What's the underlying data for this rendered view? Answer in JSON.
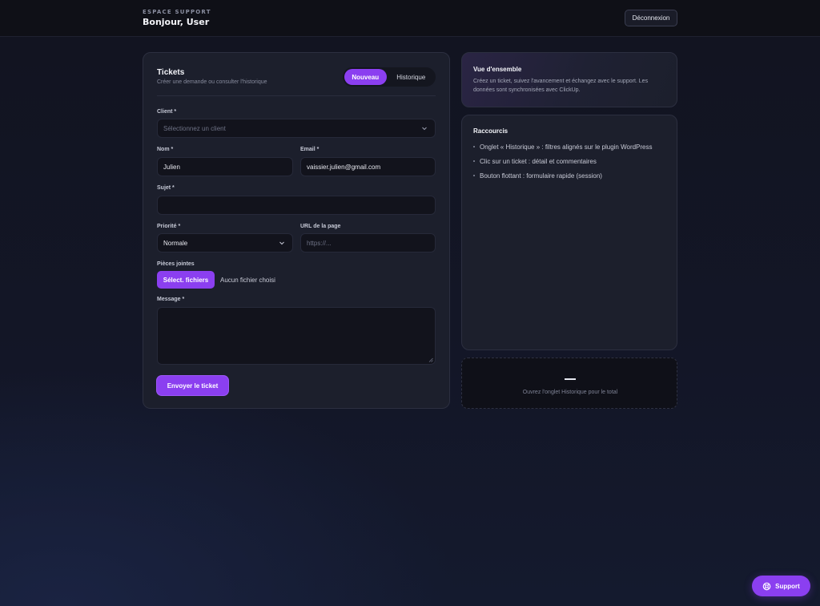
{
  "header": {
    "eyebrow": "ESPACE SUPPORT",
    "greeting": "Bonjour, User",
    "logout_label": "Déconnexion"
  },
  "tickets": {
    "title": "Tickets",
    "subtitle": "Créer une demande ou consulter l'historique",
    "tabs": [
      {
        "label": "Nouveau",
        "active": true
      },
      {
        "label": "Historique",
        "active": false
      }
    ],
    "form": {
      "client": {
        "label": "Client *",
        "placeholder": "Sélectionnez un client"
      },
      "nom": {
        "label": "Nom *",
        "value": "Julien"
      },
      "email": {
        "label": "Email *",
        "value": "vaissier.julien@gmail.com"
      },
      "sujet": {
        "label": "Sujet *",
        "value": ""
      },
      "priorite": {
        "label": "Priorité *",
        "value": "Normale"
      },
      "url": {
        "label": "URL de la page",
        "placeholder": "https://..."
      },
      "attachments": {
        "label": "Pièces jointes",
        "button_label": "Sélect. fichiers",
        "status": "Aucun fichier choisi"
      },
      "message": {
        "label": "Message *",
        "value": ""
      },
      "submit_label": "Envoyer le ticket"
    }
  },
  "overview": {
    "title": "Vue d'ensemble",
    "text": "Créez un ticket, suivez l'avancement et échangez avec le support. Les données sont synchronisées avec ClickUp."
  },
  "shortcuts": {
    "title": "Raccourcis",
    "items": [
      "Onglet « Historique » : filtres alignés sur le plugin WordPress",
      "Clic sur un ticket : détail et commentaires",
      "Bouton flottant : formulaire rapide (session)"
    ]
  },
  "stats": {
    "value": "—",
    "caption": "Ouvrez l'onglet Historique pour le total"
  },
  "support_button": {
    "label": "Support",
    "icon": "lifebuoy-icon"
  },
  "colors": {
    "accent": "#8b3ff0",
    "background": "#131627",
    "card": "#1c1f2c"
  }
}
